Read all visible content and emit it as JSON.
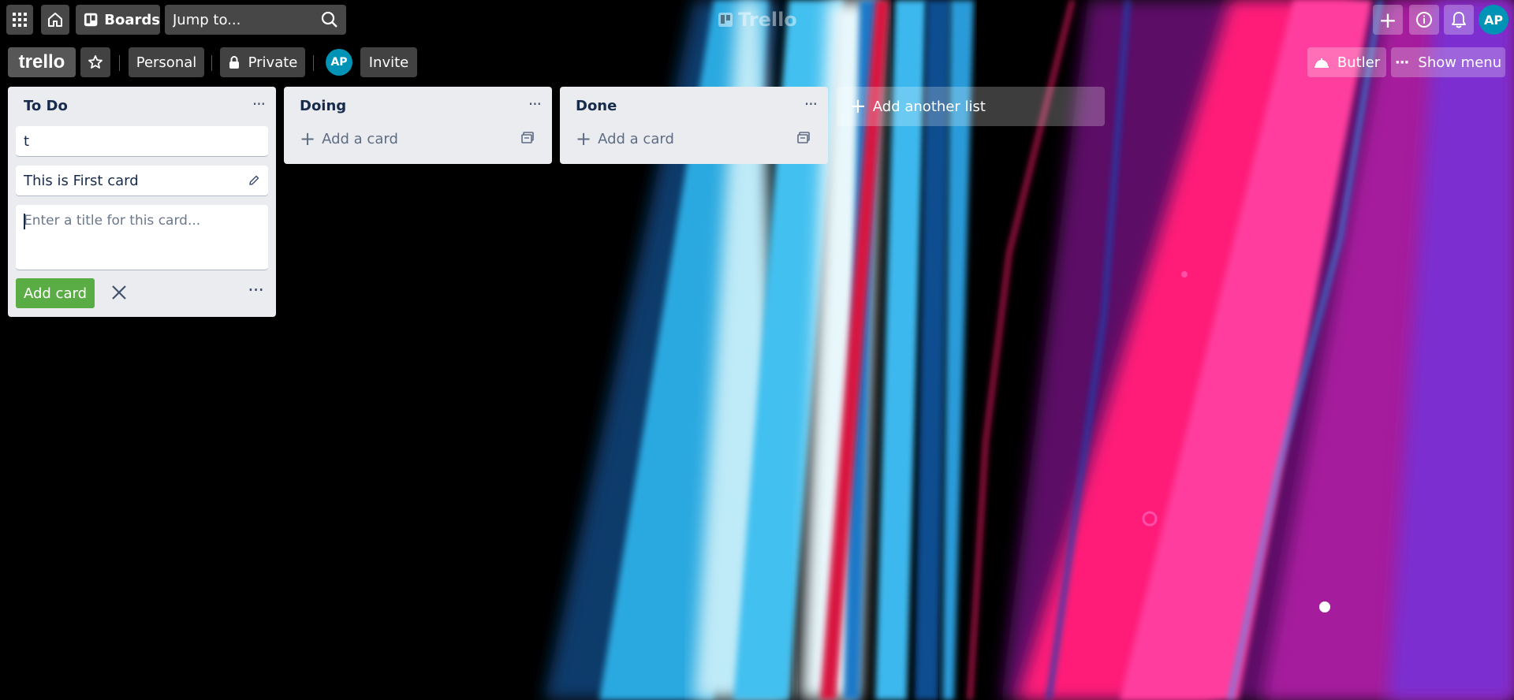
{
  "topbar": {
    "boards_label": "Boards",
    "search_placeholder": "Jump to...",
    "brand_name": "Trello",
    "user_initials": "AP"
  },
  "board": {
    "logo_text": "trello",
    "team_label": "Personal",
    "visibility_label": "Private",
    "member_initials": "AP",
    "invite_label": "Invite",
    "butler_label": "Butler",
    "menu_label": "Show menu"
  },
  "lists": [
    {
      "title": "To Do",
      "cards": [
        "t",
        "This is First card"
      ],
      "composer": {
        "placeholder": "Enter a title for this card...",
        "submit_label": "Add card"
      }
    },
    {
      "title": "Doing",
      "add_card_label": "Add a card"
    },
    {
      "title": "Done",
      "add_card_label": "Add a card"
    }
  ],
  "add_list_label": "Add another list",
  "colors": {
    "accent_green": "#5aac44",
    "avatar_teal": "#0093b5",
    "list_bg": "#ebecf0"
  }
}
